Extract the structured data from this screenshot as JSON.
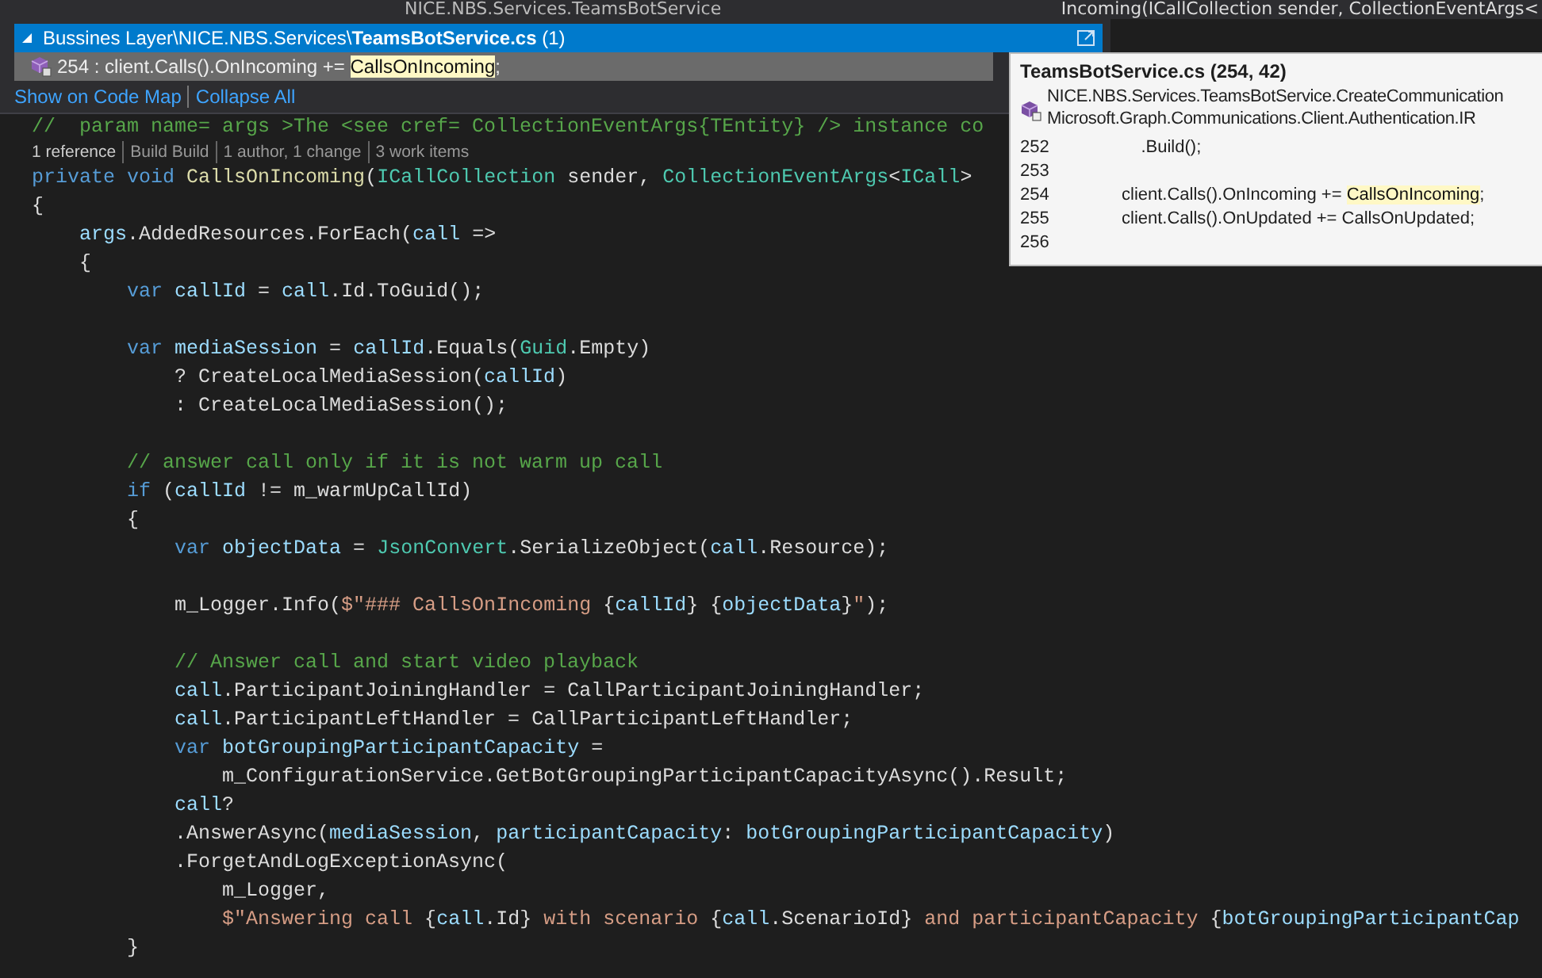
{
  "nav_bar": {
    "left_item": "NICE.NBS.Services.TeamsBotService",
    "right_item": "Incoming(ICallCollection sender, CollectionEventArgs<"
  },
  "peek": {
    "title": "Bussines Layer\\NICE.NBS.Services\\**TeamsBotService.cs** (1)",
    "expanded": true,
    "result": {
      "prefix": "254 : client.Calls().OnIncoming += ",
      "match": "CallsOnIncoming",
      "suffix": ";",
      "selected": true
    },
    "links": [
      "Show on Code Map",
      "Collapse All"
    ]
  },
  "codelens": [
    "1 reference",
    "Build Build",
    "1 author, 1 change",
    "3 work items"
  ],
  "doc_comment": "//  param name= args >The <see cref= CollectionEventArgs{TEntity} /> instance co",
  "code_lines": [
    {
      "kind": "code",
      "segments": [
        {
          "text": "private",
          "kind": "kw"
        },
        {
          "text": " void",
          "kind": "kw"
        },
        {
          "text": " CallsOnIncoming",
          "kind": "method"
        },
        {
          "text": "(",
          "kind": "plain"
        },
        {
          "text": "ICallCollection",
          "kind": "type"
        },
        {
          "text": " sender, ",
          "kind": "plain"
        },
        {
          "text": "CollectionEventArgs",
          "kind": "type"
        },
        {
          "text": "<",
          "kind": "plain"
        },
        {
          "text": "ICall",
          "kind": "type"
        },
        {
          "text": ">",
          "kind": "plain"
        }
      ]
    },
    {
      "kind": "code",
      "segments": [
        {
          "text": "{",
          "kind": "plain"
        }
      ]
    },
    {
      "kind": "code",
      "segments": [
        {
          "text": "    args",
          "kind": "id"
        },
        {
          "text": ".AddedResources.ForEach(",
          "kind": "plain"
        },
        {
          "text": "call",
          "kind": "id"
        },
        {
          "text": " =>",
          "kind": "plain"
        }
      ]
    },
    {
      "kind": "code",
      "segments": [
        {
          "text": "    {",
          "kind": "plain"
        }
      ]
    },
    {
      "kind": "code",
      "segments": [
        {
          "text": "        var",
          "kind": "kw"
        },
        {
          "text": " callId",
          "kind": "id"
        },
        {
          "text": " = ",
          "kind": "plain"
        },
        {
          "text": "call",
          "kind": "id"
        },
        {
          "text": ".Id.ToGuid();",
          "kind": "plain"
        }
      ]
    },
    {
      "kind": "blank"
    },
    {
      "kind": "code",
      "segments": [
        {
          "text": "        var",
          "kind": "kw"
        },
        {
          "text": " mediaSession",
          "kind": "id"
        },
        {
          "text": " = ",
          "kind": "plain"
        },
        {
          "text": "callId",
          "kind": "id"
        },
        {
          "text": ".Equals(",
          "kind": "plain"
        },
        {
          "text": "Guid",
          "kind": "type"
        },
        {
          "text": ".Empty)",
          "kind": "plain"
        }
      ]
    },
    {
      "kind": "code",
      "segments": [
        {
          "text": "            ? CreateLocalMediaSession(",
          "kind": "plain"
        },
        {
          "text": "callId",
          "kind": "id"
        },
        {
          "text": ")",
          "kind": "plain"
        }
      ]
    },
    {
      "kind": "code",
      "segments": [
        {
          "text": "            : CreateLocalMediaSession();",
          "kind": "plain"
        }
      ]
    },
    {
      "kind": "blank"
    },
    {
      "kind": "code",
      "segments": [
        {
          "text": "        // answer call only if it is not warm up call",
          "kind": "comment"
        }
      ]
    },
    {
      "kind": "code",
      "segments": [
        {
          "text": "        if",
          "kind": "kw"
        },
        {
          "text": " (",
          "kind": "plain"
        },
        {
          "text": "callId",
          "kind": "id"
        },
        {
          "text": " != m_warmUpCallId)",
          "kind": "plain"
        }
      ]
    },
    {
      "kind": "code",
      "segments": [
        {
          "text": "        {",
          "kind": "plain"
        }
      ]
    },
    {
      "kind": "code",
      "segments": [
        {
          "text": "            var",
          "kind": "kw"
        },
        {
          "text": " objectData",
          "kind": "id"
        },
        {
          "text": " = ",
          "kind": "plain"
        },
        {
          "text": "JsonConvert",
          "kind": "type"
        },
        {
          "text": ".SerializeObject(",
          "kind": "plain"
        },
        {
          "text": "call",
          "kind": "id"
        },
        {
          "text": ".Resource);",
          "kind": "plain"
        }
      ]
    },
    {
      "kind": "blank"
    },
    {
      "kind": "code",
      "segments": [
        {
          "text": "            m_Logger.Info(",
          "kind": "plain"
        },
        {
          "text": "$\"### CallsOnIncoming ",
          "kind": "str"
        },
        {
          "text": "{",
          "kind": "plain"
        },
        {
          "text": "callId",
          "kind": "id"
        },
        {
          "text": "} {",
          "kind": "plain"
        },
        {
          "text": "objectData",
          "kind": "id"
        },
        {
          "text": "}",
          "kind": "plain"
        },
        {
          "text": "\"",
          "kind": "str"
        },
        {
          "text": ");",
          "kind": "plain"
        }
      ]
    },
    {
      "kind": "blank"
    },
    {
      "kind": "code",
      "segments": [
        {
          "text": "            // Answer call and start video playback",
          "kind": "comment"
        }
      ]
    },
    {
      "kind": "code",
      "segments": [
        {
          "text": "            call",
          "kind": "id"
        },
        {
          "text": ".ParticipantJoiningHandler = CallParticipantJoiningHandler;",
          "kind": "plain"
        }
      ]
    },
    {
      "kind": "code",
      "segments": [
        {
          "text": "            call",
          "kind": "id"
        },
        {
          "text": ".ParticipantLeftHandler = CallParticipantLeftHandler;",
          "kind": "plain"
        }
      ]
    },
    {
      "kind": "code",
      "segments": [
        {
          "text": "            var",
          "kind": "kw"
        },
        {
          "text": " botGroupingParticipantCapacity",
          "kind": "id"
        },
        {
          "text": " =",
          "kind": "plain"
        }
      ]
    },
    {
      "kind": "code",
      "segments": [
        {
          "text": "                m_ConfigurationService.GetBotGroupingParticipantCapacityAsync().Result;",
          "kind": "plain"
        }
      ]
    },
    {
      "kind": "code",
      "segments": [
        {
          "text": "            call",
          "kind": "id"
        },
        {
          "text": "?",
          "kind": "plain"
        }
      ]
    },
    {
      "kind": "code",
      "segments": [
        {
          "text": "            .AnswerAsync(",
          "kind": "plain"
        },
        {
          "text": "mediaSession",
          "kind": "id"
        },
        {
          "text": ", ",
          "kind": "plain"
        },
        {
          "text": "participantCapacity",
          "kind": "id"
        },
        {
          "text": ": ",
          "kind": "plain"
        },
        {
          "text": "botGroupingParticipantCapacity",
          "kind": "id"
        },
        {
          "text": ")",
          "kind": "plain"
        }
      ]
    },
    {
      "kind": "code",
      "segments": [
        {
          "text": "            .ForgetAndLogExceptionAsync(",
          "kind": "plain"
        }
      ]
    },
    {
      "kind": "code",
      "segments": [
        {
          "text": "                m_Logger,",
          "kind": "plain"
        }
      ]
    },
    {
      "kind": "code",
      "segments": [
        {
          "text": "                $\"Answering call ",
          "kind": "str"
        },
        {
          "text": "{",
          "kind": "plain"
        },
        {
          "text": "call",
          "kind": "id"
        },
        {
          "text": ".Id}",
          "kind": "plain"
        },
        {
          "text": " with scenario ",
          "kind": "str"
        },
        {
          "text": "{",
          "kind": "plain"
        },
        {
          "text": "call",
          "kind": "id"
        },
        {
          "text": ".ScenarioId}",
          "kind": "plain"
        },
        {
          "text": " and participantCapacity ",
          "kind": "str"
        },
        {
          "text": "{",
          "kind": "plain"
        },
        {
          "text": "botGroupingParticipantCap",
          "kind": "id"
        }
      ]
    },
    {
      "kind": "code",
      "segments": [
        {
          "text": "        }",
          "kind": "plain"
        }
      ]
    }
  ],
  "tooltip": {
    "title": "TeamsBotService.cs (254, 42)",
    "signature": [
      "NICE.NBS.Services.TeamsBotService.CreateCommunication",
      "Microsoft.Graph.Communications.Client.Authentication.IR"
    ],
    "lines": [
      {
        "number": "252",
        "segments": [
          {
            "text": "    .Build();",
            "highlighted": false
          }
        ]
      },
      {
        "number": "253"
      },
      {
        "number": "254",
        "segments": [
          {
            "text": "client.Calls().OnIncoming += ",
            "highlighted": false
          },
          {
            "text": "CallsOnIncoming",
            "highlighted": true
          },
          {
            "text": ";",
            "highlighted": false
          }
        ]
      },
      {
        "number": "255",
        "segments": [
          {
            "text": "client.Calls().OnUpdated += CallsOnUpdated;",
            "highlighted": false
          }
        ]
      },
      {
        "number": "256"
      }
    ]
  }
}
